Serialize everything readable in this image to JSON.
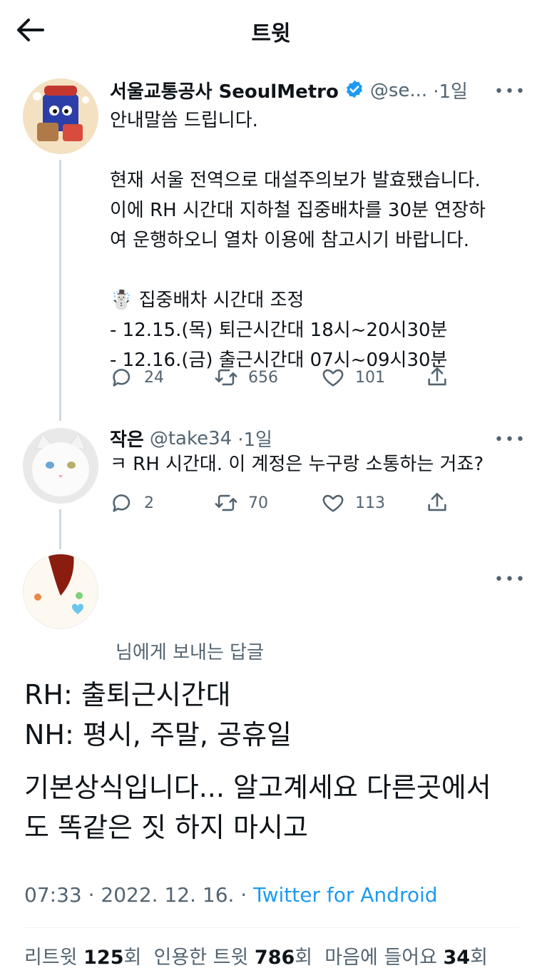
{
  "header": {
    "title": "트윗"
  },
  "tweet1": {
    "display_name": "서울교통공사 SeoulMetro",
    "handle": "@se...",
    "time": "·1일",
    "more": "•••",
    "text": "안내말씀 드립니다.\n\n현재 서울 전역으로 대설주의보가 발효됐습니다.\n이에 RH 시간대 지하철 집중배차를 30분 연장하\n여 운행하오니 열차 이용에 참고시기 바랍니다.\n\n☃️ 집중배차 시간대 조정\n- 12.15.(목) 퇴근시간대 18시~20시30분\n- 12.16.(금) 출근시간대 07시~09시30분",
    "replies": "24",
    "retweets": "656",
    "likes": "101"
  },
  "tweet2": {
    "display_name": "작은",
    "handle": "@take34",
    "time": "·1일",
    "more": "•••",
    "text": "ㅋ RH 시간대. 이 계정은 누구랑 소통하는 거죠?",
    "replies": "2",
    "retweets": "70",
    "likes": "113"
  },
  "main": {
    "more": "•••",
    "reply_to": "님에게 보내는 답글",
    "line1": "RH: 출퇴근시간대",
    "line2": "NH: 평시, 주말, 공휴일",
    "line3": "기본상식입니다... 알고계세요 다른곳에서",
    "line4": "도 똑같은 짓 하지 마시고",
    "timestamp": "07:33 · 2022. 12. 16. · ",
    "client": "Twitter for Android",
    "stats": {
      "retweets_label": "리트윗",
      "retweets_count": "125",
      "retweets_unit": "회",
      "quotes_label": "인용한 트윗",
      "quotes_count": "786",
      "quotes_unit": "회",
      "likes_label": "마음에 들어요",
      "likes_count": "34",
      "likes_unit": "회"
    }
  },
  "colors": {
    "accent": "#1d9bf0",
    "secondary_text": "#536471",
    "thread_line": "#cfd9de"
  }
}
